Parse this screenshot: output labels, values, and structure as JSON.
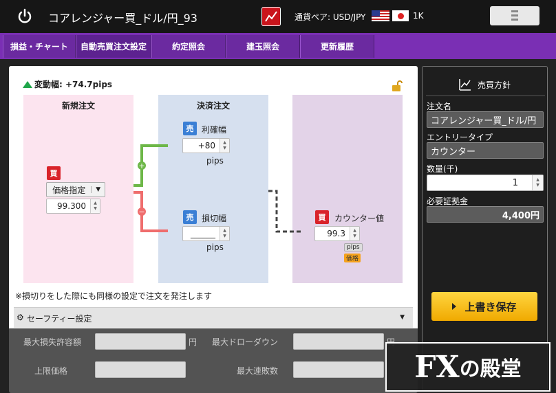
{
  "header": {
    "title": "コアレンジャー買_ドル/円_93",
    "pair_label": "通貨ペア: USD/JPY",
    "lot": "1K"
  },
  "tabs": [
    {
      "label": "損益・チャート"
    },
    {
      "label": "自動売買注文設定"
    },
    {
      "label": "約定照会"
    },
    {
      "label": "建玉照会"
    },
    {
      "label": "更新履歴"
    }
  ],
  "main": {
    "change_label": "変動幅: +74.7pips",
    "new_order": {
      "title": "新規注文",
      "side": "買",
      "type": "価格指定",
      "price": "99.300"
    },
    "settle": {
      "title": "決済注文",
      "tp_side": "売",
      "tp_label": "利確幅",
      "tp_value": "+80",
      "tp_unit": "pips",
      "sl_side": "売",
      "sl_label": "損切幅",
      "sl_value": "______",
      "sl_unit": "pips"
    },
    "counter": {
      "side": "買",
      "label": "カウンター値",
      "value": "99.3",
      "unit": "pips",
      "price_tag": "価格"
    },
    "note": "※損切りをした際にも同様の設定で注文を発注します",
    "safety": {
      "title": "セーフティー設定",
      "max_loss_label": "最大損失許容額",
      "max_loss_unit": "円",
      "max_dd_label": "最大ドローダウン",
      "max_dd_unit": "円",
      "upper_label": "上限価格",
      "max_consec_label": "最大連敗数"
    }
  },
  "side": {
    "title": "売買方針",
    "order_name_label": "注文名",
    "order_name": "コアレンジャー買_ドル/円",
    "entry_type_label": "エントリータイプ",
    "entry_type": "カウンター",
    "qty_label": "数量(千)",
    "qty": "1",
    "margin_label": "必要証拠金",
    "margin": "4,400円",
    "save_label": "上書き保存"
  },
  "watermark": {
    "text_a": "FX",
    "text_b": "の殿堂"
  },
  "colors": {
    "accent": "#7a2fb4",
    "buy": "#d9232a",
    "sell": "#3a7fd5",
    "save": "#f5b800"
  }
}
